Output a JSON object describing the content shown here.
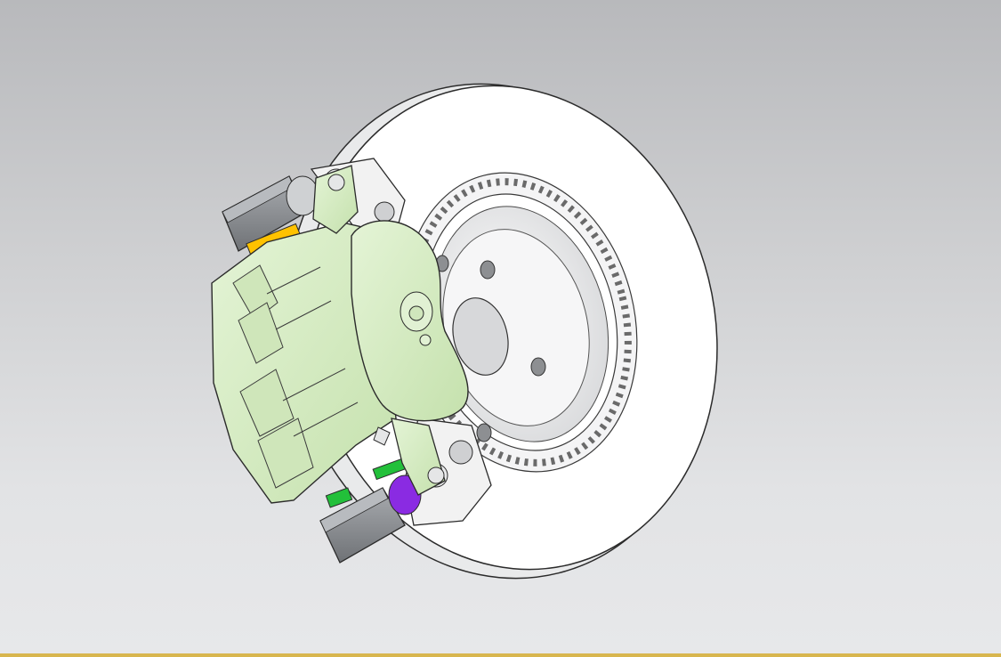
{
  "viewport": {
    "background_top": "#b8b9bc",
    "background_bottom": "#e7e8ea",
    "status_line_color": "#d8b64e"
  },
  "model": {
    "disc_color": "#ffffff",
    "caliper_color": "#d9efc6",
    "bracket_color": "#f2f2f2",
    "pad_housing_color": "#8f9296",
    "accent_colors": [
      "#ffc200",
      "#22c03a",
      "#8a2be2",
      "#ff8c1a"
    ],
    "edge_color": "#2b2b2b"
  }
}
